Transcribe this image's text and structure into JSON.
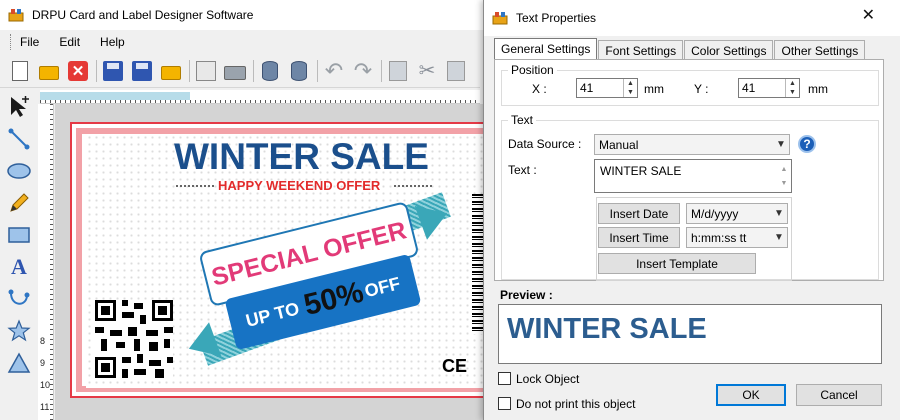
{
  "app": {
    "title": "DRPU Card and Label Designer Software",
    "menu": [
      "File",
      "Edit",
      "Help"
    ]
  },
  "ruler": {
    "left_numbers": [
      "8",
      "9",
      "10",
      "11"
    ]
  },
  "card": {
    "title": "WINTER SALE",
    "subtitle": "HAPPY WEEKEND OFFER",
    "special": "SPECIAL OFFER",
    "upto_prefix": "UP TO",
    "upto_percent": "50%",
    "upto_suffix": "OFF",
    "mark": "CE",
    "colors": {
      "title": "#1b4f8c",
      "subtitle": "#e22b2b",
      "special": "#e23a78",
      "badge": "#1773c4",
      "border": "#e53946"
    }
  },
  "dialog": {
    "title": "Text Properties",
    "close_glyph": "✕",
    "tabs": [
      "General Settings",
      "Font Settings",
      "Color Settings",
      "Other Settings"
    ],
    "position": {
      "label": "Position",
      "x_label": "X :",
      "x_value": "41",
      "x_unit": "mm",
      "y_label": "Y :",
      "y_value": "41",
      "y_unit": "mm"
    },
    "text_group": {
      "label": "Text",
      "data_source_label": "Data Source :",
      "data_source_value": "Manual",
      "help": "?",
      "text_label": "Text :",
      "text_value": "WINTER SALE",
      "insert_date": "Insert Date",
      "date_format": "M/d/yyyy",
      "insert_time": "Insert Time",
      "time_format": "h:mm:ss tt",
      "insert_template": "Insert Template"
    },
    "preview": {
      "label": "Preview :",
      "text": "WINTER SALE"
    },
    "lock_object": "Lock Object",
    "do_not_print": "Do not print this object",
    "ok": "OK",
    "cancel": "Cancel"
  }
}
